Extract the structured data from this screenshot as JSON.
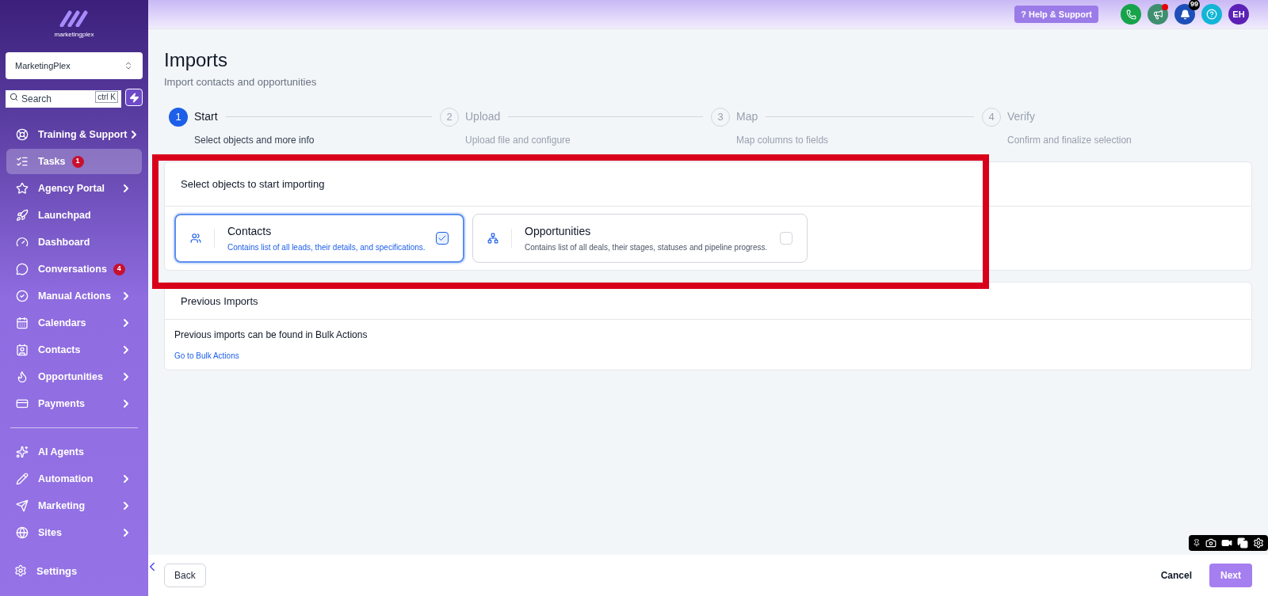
{
  "sidebar": {
    "logo_text": "marketingplex",
    "account": "MarketingPlex",
    "search": {
      "placeholder": "Search",
      "shortcut": "ctrl K"
    },
    "items": [
      {
        "label": "Training & Support",
        "chevron": true,
        "selected": false
      },
      {
        "label": "Tasks",
        "badge": "1",
        "chevron": false,
        "selected": true
      },
      {
        "label": "Agency Portal",
        "chevron": true,
        "selected": false
      },
      {
        "label": "Launchpad",
        "chevron": false,
        "selected": false
      },
      {
        "label": "Dashboard",
        "chevron": false,
        "selected": false
      },
      {
        "label": "Conversations",
        "badge": "4",
        "chevron": false,
        "selected": false
      },
      {
        "label": "Manual Actions",
        "chevron": true,
        "selected": false
      },
      {
        "label": "Calendars",
        "chevron": true,
        "selected": false
      },
      {
        "label": "Contacts",
        "chevron": true,
        "selected": false
      },
      {
        "label": "Opportunities",
        "chevron": true,
        "selected": false
      },
      {
        "label": "Payments",
        "chevron": true,
        "selected": false
      }
    ],
    "items_2": [
      {
        "label": "AI Agents",
        "chevron": false,
        "selected": false
      },
      {
        "label": "Automation",
        "chevron": true,
        "selected": false
      },
      {
        "label": "Marketing",
        "chevron": true,
        "selected": false
      },
      {
        "label": "Sites",
        "chevron": true,
        "selected": false
      }
    ],
    "settings": "Settings"
  },
  "topbar": {
    "help": "? Help & Support",
    "notification_count": "99",
    "avatar": "EH"
  },
  "page": {
    "title": "Imports",
    "subtitle": "Import contacts and opportunities"
  },
  "steps": [
    {
      "number": "1",
      "title": "Start",
      "subtitle": "Select objects and more info",
      "selected": true
    },
    {
      "number": "2",
      "title": "Upload",
      "subtitle": "Upload file and configure",
      "selected": false
    },
    {
      "number": "3",
      "title": "Map",
      "subtitle": "Map columns to fields",
      "selected": false
    },
    {
      "number": "4",
      "title": "Verify",
      "subtitle": "Confirm and finalize selection",
      "selected": false
    }
  ],
  "select_card": {
    "heading": "Select objects to start importing",
    "options": [
      {
        "title": "Contacts",
        "description": "Contains list of all leads, their details, and specifications.",
        "checked": true
      },
      {
        "title": "Opportunities",
        "description": "Contains list of all deals, their stages, statuses and pipeline progress.",
        "checked": false
      }
    ]
  },
  "previous_card": {
    "heading": "Previous Imports",
    "text": "Previous imports can be found in Bulk Actions",
    "link": "Go to Bulk Actions"
  },
  "footer": {
    "back": "Back",
    "cancel": "Cancel",
    "next": "Next"
  }
}
